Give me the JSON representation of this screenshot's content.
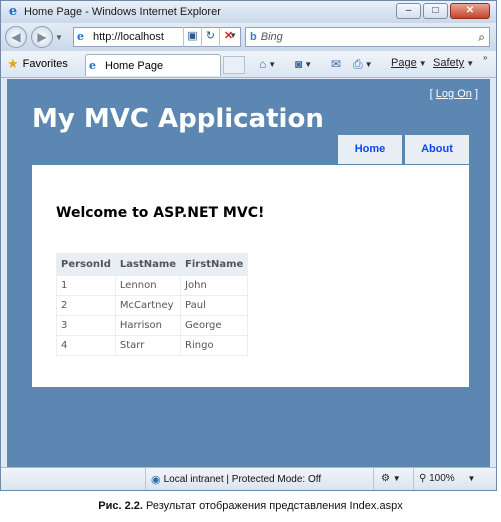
{
  "window": {
    "title": "Home Page - Windows Internet Explorer",
    "controls": {
      "minimize": "–",
      "maximize": "□",
      "close": "✕"
    }
  },
  "navbar": {
    "back_icon": "back-arrow-icon",
    "forward_icon": "forward-arrow-icon",
    "address": "http://localhost",
    "search_placeholder": "Bing"
  },
  "favbar": {
    "favorites_label": "Favorites",
    "tab_label": "Home Page",
    "page_label": "Page",
    "safety_label": "Safety"
  },
  "site": {
    "logon_open": "[",
    "logon_link": "Log On",
    "logon_close": "]",
    "title": "My MVC Application",
    "menu": [
      {
        "label": "Home"
      },
      {
        "label": "About"
      }
    ],
    "welcome": "Welcome to ASP.NET MVC!",
    "table": {
      "headers": [
        "PersonId",
        "LastName",
        "FirstName"
      ],
      "rows": [
        [
          "1",
          "Lennon",
          "John"
        ],
        [
          "2",
          "McCartney",
          "Paul"
        ],
        [
          "3",
          "Harrison",
          "George"
        ],
        [
          "4",
          "Starr",
          "Ringo"
        ]
      ]
    }
  },
  "statusbar": {
    "zone": "Local intranet | Protected Mode: Off",
    "zoom": "100%"
  },
  "caption": {
    "figure": "Рис. 2.2.",
    "text": "Результат отображения представления Index.aspx"
  },
  "colors": {
    "page_bg": "#5c87b2",
    "menu_bg": "#e8eef4",
    "menu_text": "#034af3"
  }
}
